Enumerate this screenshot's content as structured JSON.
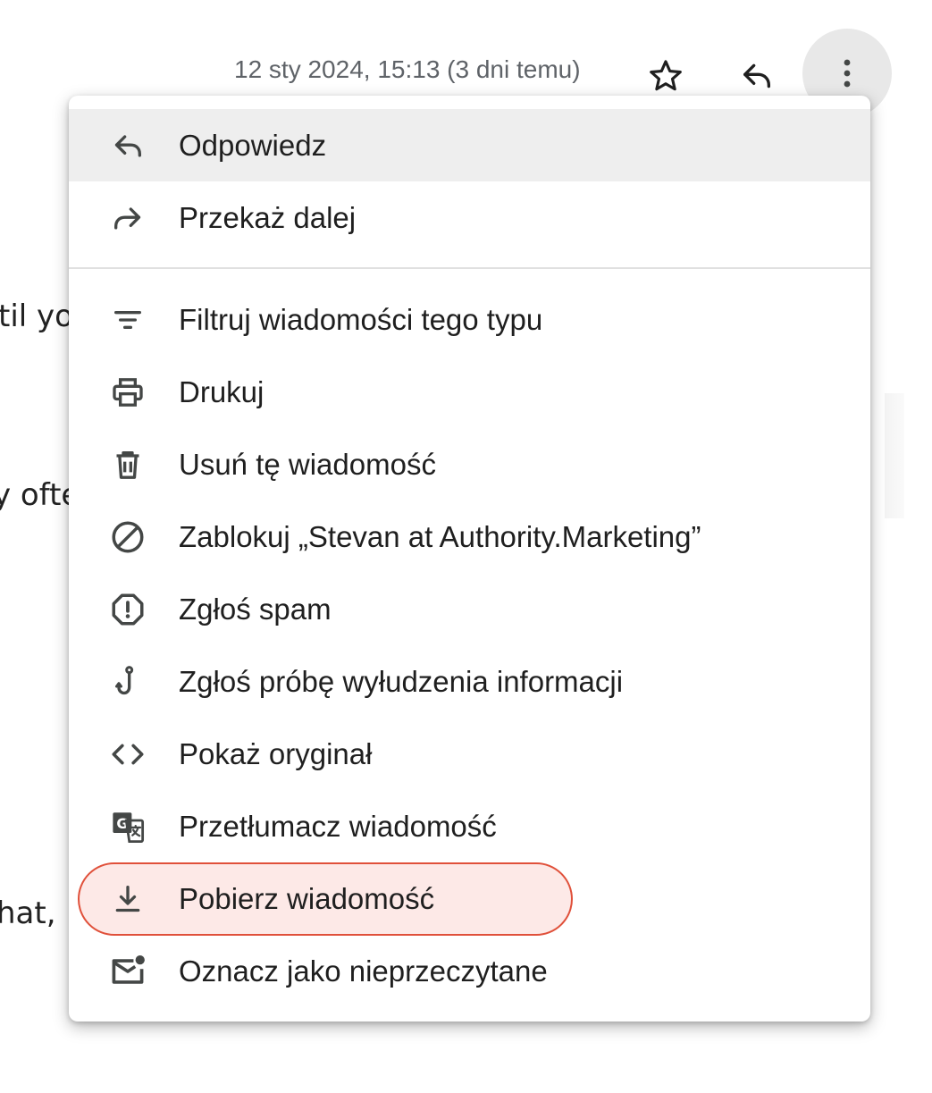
{
  "background": {
    "fragments": [
      "til yo",
      "y ofte",
      "hat,"
    ]
  },
  "header": {
    "date": "12 sty 2024, 15:13 (3 dni temu)",
    "star_icon": "star-outline-icon",
    "reply_icon": "reply-icon",
    "more_icon": "more-vert-icon"
  },
  "menu": {
    "items": [
      {
        "label": "Odpowiedz",
        "icon": "reply-icon"
      },
      {
        "label": "Przekaż dalej",
        "icon": "forward-icon"
      },
      {
        "label": "Filtruj wiadomości tego typu",
        "icon": "filter-icon"
      },
      {
        "label": "Drukuj",
        "icon": "print-icon"
      },
      {
        "label": "Usuń tę wiadomość",
        "icon": "trash-icon"
      },
      {
        "label": "Zablokuj „Stevan at Authority.Marketing”",
        "icon": "block-icon"
      },
      {
        "label": "Zgłoś spam",
        "icon": "report-icon"
      },
      {
        "label": "Zgłoś próbę wyłudzenia informacji",
        "icon": "phishing-hook-icon"
      },
      {
        "label": "Pokaż oryginał",
        "icon": "code-icon"
      },
      {
        "label": "Przetłumacz wiadomość",
        "icon": "translate-icon"
      },
      {
        "label": "Pobierz wiadomość",
        "icon": "download-icon"
      },
      {
        "label": "Oznacz jako nieprzeczytane",
        "icon": "mark-unread-icon"
      }
    ]
  },
  "colors": {
    "highlight_border": "#e0503a",
    "highlight_fill": "#fde9e7",
    "hover_fill": "#eeeeee",
    "icon": "#444746"
  }
}
